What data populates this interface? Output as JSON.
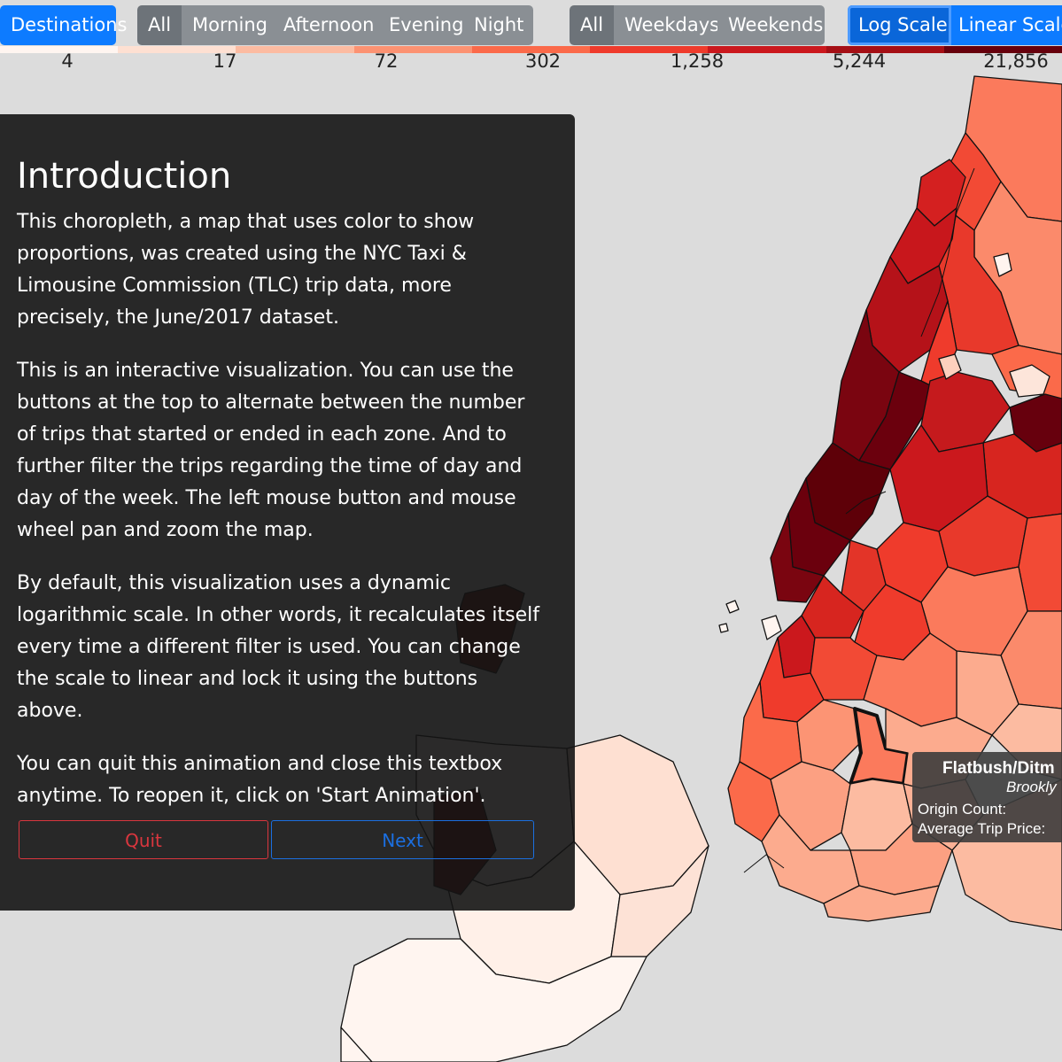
{
  "toolbar": {
    "direction": {
      "destinations": "Destinations"
    },
    "time_of_day": {
      "all": "All",
      "morning": "Morning",
      "afternoon": "Afternoon",
      "evening": "Evening",
      "night": "Night"
    },
    "day_of_week": {
      "all": "All",
      "weekdays": "Weekdays",
      "weekends": "Weekends"
    },
    "scale": {
      "log": "Log Scale",
      "linear": "Linear Scale"
    }
  },
  "legend": {
    "labels": [
      "4",
      "17",
      "72",
      "302",
      "1,258",
      "5,244",
      "21,856"
    ],
    "colors": [
      "#fff5f0",
      "#fee0d2",
      "#fcbba1",
      "#fc9272",
      "#fb6a4a",
      "#ef3b2c",
      "#cb181d",
      "#a50f15",
      "#67000d"
    ]
  },
  "intro": {
    "title": "Introduction",
    "paragraphs": [
      "This choropleth, a map that uses color to show proportions, was created using the NYC Taxi & Limousine Commission (TLC) trip data, more precisely, the June/2017 dataset.",
      "This is an interactive visualization. You can use the buttons at the top to alternate between the number of trips that started or ended in each zone. And to further filter the trips regarding the time of day and day of the week. The left mouse button and mouse wheel pan and zoom the map.",
      "By default, this visualization uses a dynamic logarithmic scale. In other words, it recalculates itself every time a different filter is used. You can change the scale to linear and lock it using the buttons above.",
      "You can quit this animation and close this textbox anytime. To reopen it, click on 'Start Animation'."
    ],
    "quit_label": "Quit",
    "next_label": "Next"
  },
  "tooltip": {
    "zone": "Flatbush/Ditm",
    "borough": "Brookly",
    "origin_count_label": "Origin Count:",
    "avg_price_label": "Average Trip Price:"
  },
  "map_colors": {
    "background": "#dcdcdc",
    "stroke": "#111111",
    "highlight_stroke": "#000000"
  }
}
